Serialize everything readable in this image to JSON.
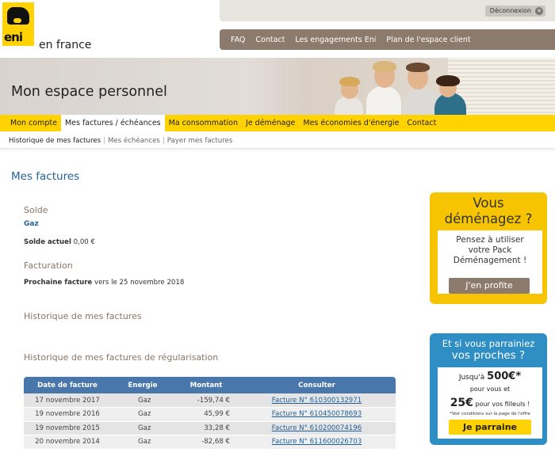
{
  "brand": {
    "logo_text": "eni",
    "tagline": "en france"
  },
  "topbar": {
    "logout_label": "Déconnexion"
  },
  "utility_nav": [
    "FAQ",
    "Contact",
    "Les engagements Eni",
    "Plan de l'espace client"
  ],
  "banner": {
    "title": "Mon espace personnel"
  },
  "main_nav": {
    "items": [
      "Mon compte",
      "Mes factures / échéances",
      "Ma consommation",
      "Je déménage",
      "Mes économies d'énergie",
      "Contact"
    ],
    "active": "Mes factures / échéances"
  },
  "sub_nav": {
    "current": "Historique de mes factures",
    "links": [
      "Mes échéances",
      "Payer mes factures"
    ]
  },
  "page": {
    "title": "Mes factures",
    "solde": {
      "heading": "Solde",
      "energy": "Gaz",
      "label": "Solde actuel",
      "value": "0,00 €"
    },
    "facturation": {
      "heading": "Facturation",
      "label": "Prochaine facture",
      "value": "vers le 25 novembre 2018"
    },
    "historique_heading": "Historique de mes factures",
    "regul_heading": "Historique de mes factures de régularisation"
  },
  "invoice_table": {
    "headers": [
      "Date de facture",
      "Energie",
      "Montant",
      "Consulter"
    ],
    "rows": [
      [
        "17 novembre 2017",
        "Gaz",
        "-159,74 €",
        "Facture N° 610300132971"
      ],
      [
        "19 novembre 2016",
        "Gaz",
        "45,99 €",
        "Facture N° 610450078693"
      ],
      [
        "19 novembre 2015",
        "Gaz",
        "33,28 €",
        "Facture N° 610200074196"
      ],
      [
        "20 novembre 2014",
        "Gaz",
        "-82,68 €",
        "Facture N° 611600026703"
      ]
    ]
  },
  "ad_move": {
    "title_1": "Vous",
    "title_2": "déménagez ?",
    "body_1": "Pensez à utiliser",
    "body_2": "votre Pack",
    "body_3": "Déménagement !",
    "button": "J'en profite"
  },
  "ad_referral": {
    "title_1": "Et si vous parrainiez",
    "title_2": "vos proches ?",
    "line_1_prefix": "Jusqu'à",
    "line_1_amount": "500€*",
    "line_2": "pour vous et",
    "line_3_amount": "25€",
    "line_3_suffix": "pour vos filleuls !",
    "note": "*Voir conditions sur la page de l'offre",
    "button": "Je parraine"
  },
  "colors": {
    "eni_yellow": "#ffd200",
    "brown": "#8c7b6c",
    "link_blue": "#21619a",
    "table_header": "#4a77ab",
    "referral_blue": "#2f8fc4"
  }
}
